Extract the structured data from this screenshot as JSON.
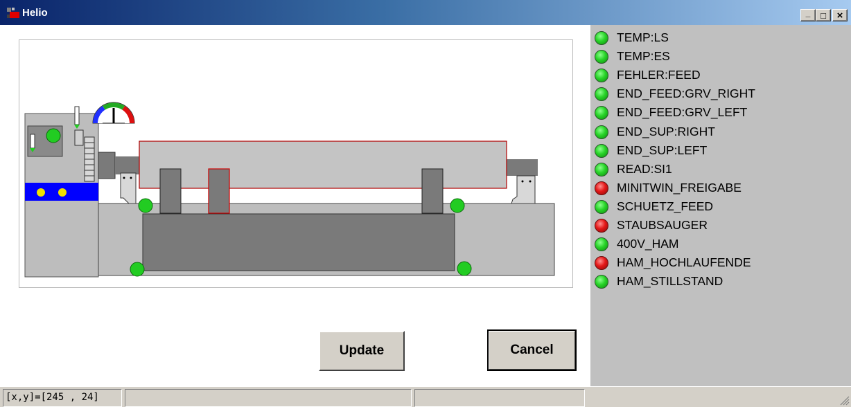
{
  "window": {
    "title": "Helio",
    "minimize_glyph": "_",
    "maximize_glyph": "□",
    "close_glyph": "×"
  },
  "buttons": {
    "update_label": "Update",
    "cancel_label": "Cancel"
  },
  "status_list": [
    {
      "label": "TEMP:LS",
      "state": "green"
    },
    {
      "label": "TEMP:ES",
      "state": "green"
    },
    {
      "label": "FEHLER:FEED",
      "state": "green"
    },
    {
      "label": "END_FEED:GRV_RIGHT",
      "state": "green"
    },
    {
      "label": "END_FEED:GRV_LEFT",
      "state": "green"
    },
    {
      "label": "END_SUP:RIGHT",
      "state": "green"
    },
    {
      "label": "END_SUP:LEFT",
      "state": "green"
    },
    {
      "label": "READ:SI1",
      "state": "green"
    },
    {
      "label": "MINITWIN_FREIGABE",
      "state": "red"
    },
    {
      "label": "SCHUETZ_FEED",
      "state": "green"
    },
    {
      "label": "STAUBSAUGER",
      "state": "red"
    },
    {
      "label": "400V_HAM",
      "state": "green"
    },
    {
      "label": "HAM_HOCHLAUFENDE",
      "state": "red"
    },
    {
      "label": "HAM_STILLSTAND",
      "state": "green"
    }
  ],
  "statusbar": {
    "coords": "[x,y]=[245 , 24]",
    "pane2": "",
    "pane3": "",
    "pane4": ""
  },
  "colors": {
    "led_green": "#28d428",
    "led_red": "#e41818",
    "panel_gray": "#c0c0c0",
    "machine_gray": "#bdbdbd",
    "machine_dark": "#7a7a7a",
    "accent_blue": "#0000ff",
    "outline_red": "#cc0000"
  }
}
